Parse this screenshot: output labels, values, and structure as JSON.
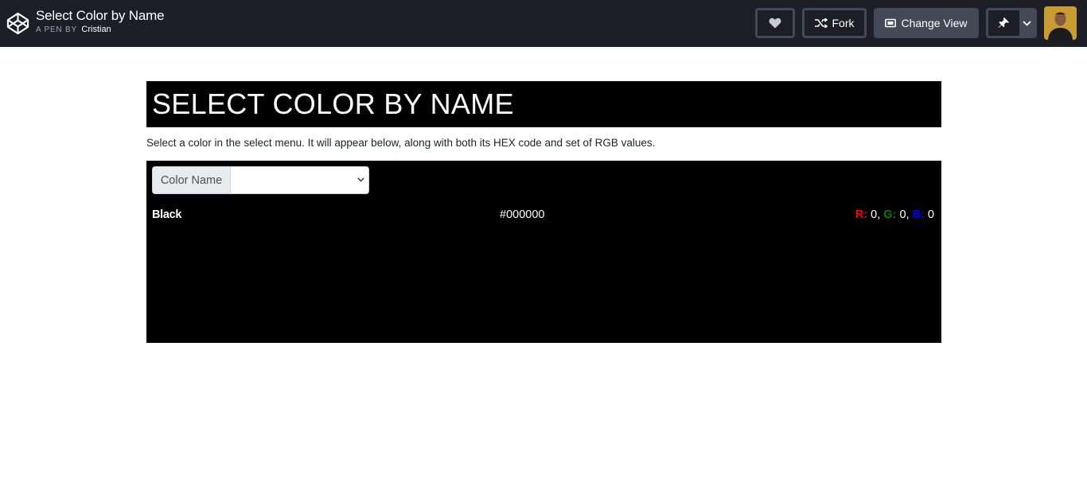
{
  "header": {
    "pen_title": "Select Color by Name",
    "byline_prefix": "A PEN BY",
    "author": "Cristian",
    "fork_label": "Fork",
    "change_view_label": "Change View"
  },
  "main": {
    "heading": "SELECT COLOR BY NAME",
    "description": "Select a color in the select menu. It will appear below, along with both its HEX code and set of RGB values.",
    "select_label": "Color Name",
    "select_value": "",
    "color_name": "Black",
    "hex": "#000000",
    "rgb": {
      "r_label": "R:",
      "r_value": "0",
      "g_label": "G:",
      "g_value": "0",
      "b_label": "B:",
      "b_value": "0"
    }
  },
  "colors": {
    "topbar_bg": "#1e1f26",
    "button_border": "#444857",
    "panel_bg": "#000000",
    "r": "#ff0000",
    "g": "#008000",
    "b": "#0000ff"
  },
  "icons": [
    "codepen-logo-icon",
    "heart-icon",
    "fork-icon",
    "change-view-icon",
    "pin-icon",
    "chevron-down-icon"
  ]
}
